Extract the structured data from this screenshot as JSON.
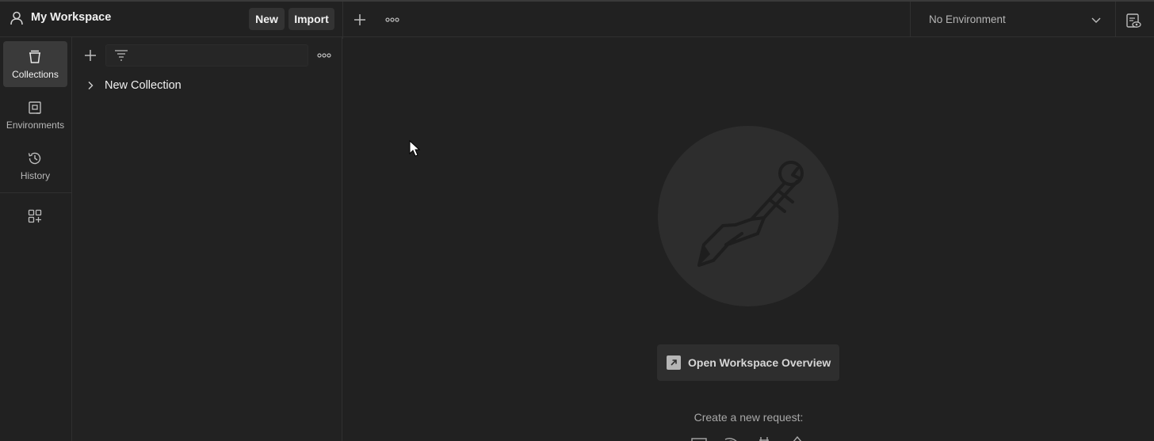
{
  "header": {
    "workspace_title": "My Workspace",
    "new_label": "New",
    "import_label": "Import",
    "environment": "No Environment"
  },
  "sidebar": {
    "items": [
      {
        "label": "Collections",
        "icon": "collections-icon",
        "active": true
      },
      {
        "label": "Environments",
        "icon": "environments-icon",
        "active": false
      },
      {
        "label": "History",
        "icon": "history-icon",
        "active": false
      }
    ]
  },
  "collections": {
    "items": [
      {
        "name": "New Collection"
      }
    ]
  },
  "main": {
    "overview_label": "Open Workspace Overview",
    "create_request_label": "Create a new request:",
    "request_types": [
      "http-request-icon",
      "websocket-request-icon",
      "grpc-request-icon",
      "graphql-request-icon"
    ]
  },
  "colors": {
    "background": "#212121",
    "active_item": "#3a3a3a",
    "logo_circle": "#2d2d2d",
    "text": "#e6e6e6"
  }
}
